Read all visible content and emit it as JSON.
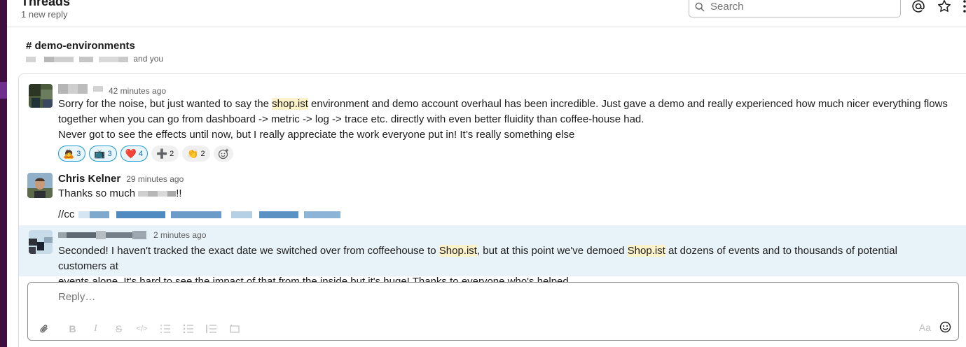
{
  "header": {
    "title": "Threads",
    "subtitle": "1 new reply",
    "search_placeholder": "Search"
  },
  "channel": {
    "name": "# demo-environments",
    "members_suffix": "and you"
  },
  "messages": [
    {
      "time": "42 minutes ago",
      "lines": {
        "l1a": "Sorry for the noise, but just wanted to say the ",
        "l1hl": "shop.ist",
        "l1b": " environment and demo account overhaul has been incredible. Just gave a demo and really experienced how much nicer everything flows",
        "l2": "together when you can go from dashboard -> metric -> log -> trace etc. directly with even better fluidity than coffee-house had.",
        "l3": "Never got to see the effects until now, but I really appreciate the work everyone put in! It’s really something else"
      },
      "reactions": [
        {
          "emoji": "🙇",
          "count": "3",
          "mine": true
        },
        {
          "emoji": "📺",
          "count": "3",
          "mine": true
        },
        {
          "emoji": "❤️",
          "count": "4",
          "mine": true
        },
        {
          "emoji": "➕",
          "count": "2",
          "mine": false
        },
        {
          "emoji": "👏",
          "count": "2",
          "mine": false
        }
      ]
    },
    {
      "author": "Chris Kelner",
      "time": "29 minutes ago",
      "line1": "Thanks so much ",
      "line1_end": "!!",
      "cc": "//cc"
    },
    {
      "time": "2 minutes ago",
      "p1": "Seconded! I haven't tracked the exact date we switched over from coffeehouse to ",
      "hl1": "Shop.ist",
      "p2": ", but at this point we've demoed ",
      "hl2": "Shop.ist",
      "p3": " at dozens of events and to thousands of potential customers at",
      "line2": "events alone. It's hard to see the impact of that from the inside but it's huge! Thanks to everyone who's helped."
    }
  ],
  "composer": {
    "placeholder": "Reply…",
    "format_label": "Aa"
  },
  "icons": {
    "search": "search-icon",
    "mention": "at-sign-icon",
    "star": "star-icon",
    "more": "more-vertical-icon",
    "attach": "paperclip-icon",
    "emoji": "smiley-icon"
  },
  "colors": {
    "sidebar": "#3f0e40",
    "highlight_bg": "#fcf2c9",
    "new_msg_bg": "#e8f3f9",
    "reaction_mine_border": "#1d9bd1"
  }
}
